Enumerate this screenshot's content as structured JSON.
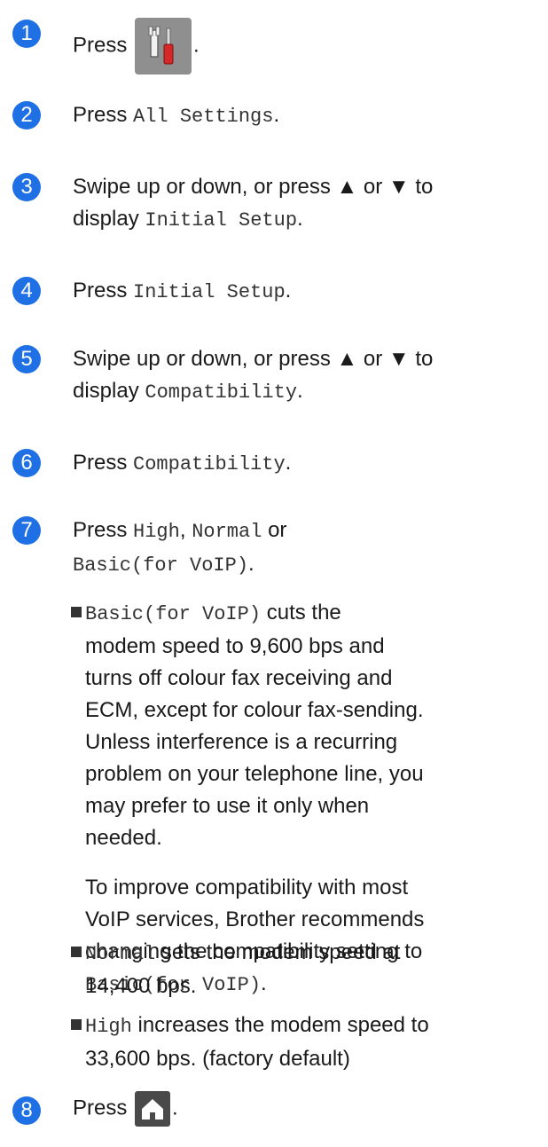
{
  "steps": [
    {
      "num": "1",
      "pre": "Press",
      "post": "."
    },
    {
      "num": "2",
      "pre": "Press",
      "code": "All Settings",
      "post": "."
    },
    {
      "num": "3",
      "line1": "Swipe up or down, or press ▲ or ▼ to",
      "line2_pre": "display",
      "code": "Initial Setup",
      "post": "."
    },
    {
      "num": "4",
      "pre": "Press",
      "code": "Initial Setup",
      "post": "."
    },
    {
      "num": "5",
      "line1": "Swipe up or down, or press ▲ or ▼ to",
      "line2_pre": "display",
      "code": "Compatibility",
      "post": "."
    },
    {
      "num": "6",
      "pre": "Press",
      "code": "Compatibility",
      "post": "."
    },
    {
      "num": "7",
      "pre": "Press",
      "code_a": "High",
      "sep1": ",",
      "code_b": "Normal",
      "sep2": "or",
      "code_c": "Basic(for VoIP)",
      "post": "."
    },
    {
      "num": "8",
      "pre": "Press",
      "post": "."
    }
  ],
  "bullets": {
    "basic": {
      "code": "Basic(for VoIP)",
      "l1": "cuts the",
      "lines": [
        "modem speed to 9,600 bps and",
        "turns off colour fax receiving and",
        "ECM, except for colour fax-sending.",
        "Unless interference is a recurring",
        "problem on your telephone line, you",
        "may prefer to use it only when",
        "needed."
      ],
      "p2": [
        "To improve compatibility with most",
        "VoIP services, Brother recommends",
        "changing the compatibility setting to"
      ],
      "p2_code": "Basic(for VoIP)",
      "p2_post": "."
    },
    "normal": {
      "code": "Normal",
      "l1": "sets the modem speed at",
      "l2": "14,400 bps."
    },
    "high": {
      "code": "High",
      "l1": "increases the modem speed to",
      "l2": "33,600 bps. (factory default)"
    }
  },
  "icons": {
    "step1": "settings-tools-icon",
    "step8": "home-icon"
  }
}
